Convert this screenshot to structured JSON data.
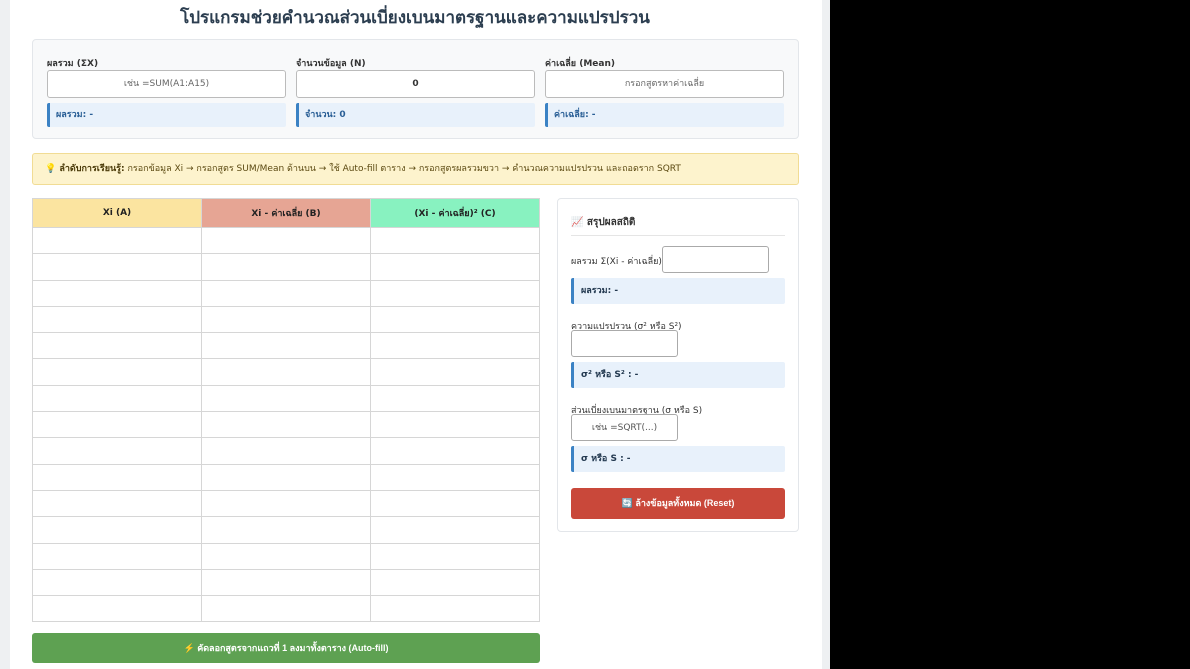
{
  "title": "โปรแกรมช่วยคำนวณส่วนเบี่ยงเบนมาตรฐานและความแปรปรวน",
  "top": {
    "sum": {
      "label": "ผลรวม (ΣX)",
      "placeholder": "เช่น =SUM(A1:A15)",
      "value": "",
      "result": "ผลรวม: -"
    },
    "count": {
      "label": "จำนวนข้อมูล (N)",
      "placeholder": "",
      "value": "0",
      "result": "จำนวน: 0"
    },
    "mean": {
      "label": "ค่าเฉลี่ย (Mean)",
      "placeholder": "กรอกสูตรหาค่าเฉลี่ย",
      "value": "",
      "result": "ค่าเฉลี่ย: -"
    }
  },
  "hint": {
    "icon": "lightbulb-icon",
    "bold": "💡 ลำดับการเรียนรู้:",
    "text": " กรอกข้อมูล Xi → กรอกสูตร SUM/Mean ด้านบน → ใช้ Auto-fill ตาราง → กรอกสูตรผลรวมขวา → คำนวณความแปรปรวน และถอดราก SQRT"
  },
  "table": {
    "headers": [
      "Xi (A)",
      "Xi - ค่าเฉลี่ย (B)",
      "(Xi - ค่าเฉลี่ย)² (C)"
    ],
    "header_colors": [
      "#fbe4a0",
      "#e6a594",
      "#88f2c0"
    ],
    "row_count": 15
  },
  "autofill_label": "⚡ คัดลอกสูตรจากแถวที่ 1 ลงมาทั้งตาราง (Auto-fill)",
  "summary": {
    "title": "📈 สรุปผลสถิติ",
    "sumsq": {
      "label": "ผลรวม Σ(Xi - ค่าเฉลี่ย)²",
      "placeholder": "",
      "result": "ผลรวม: -"
    },
    "variance": {
      "label": "ความแปรปรวน (σ² หรือ S²)",
      "placeholder": "",
      "result": "σ² หรือ S² : -"
    },
    "sd": {
      "label": "ส่วนเบี่ยงเบนมาตรฐาน (σ หรือ S)",
      "placeholder": "เช่น =SQRT(...)",
      "result": "σ หรือ S : -"
    },
    "reset_label": "🔄 ล้างข้อมูลทั้งหมด (Reset)"
  },
  "colors": {
    "accent": "#3b82c4",
    "autofill": "#5ea152",
    "reset": "#c9483a",
    "hint_bg": "#fdf3cd"
  }
}
